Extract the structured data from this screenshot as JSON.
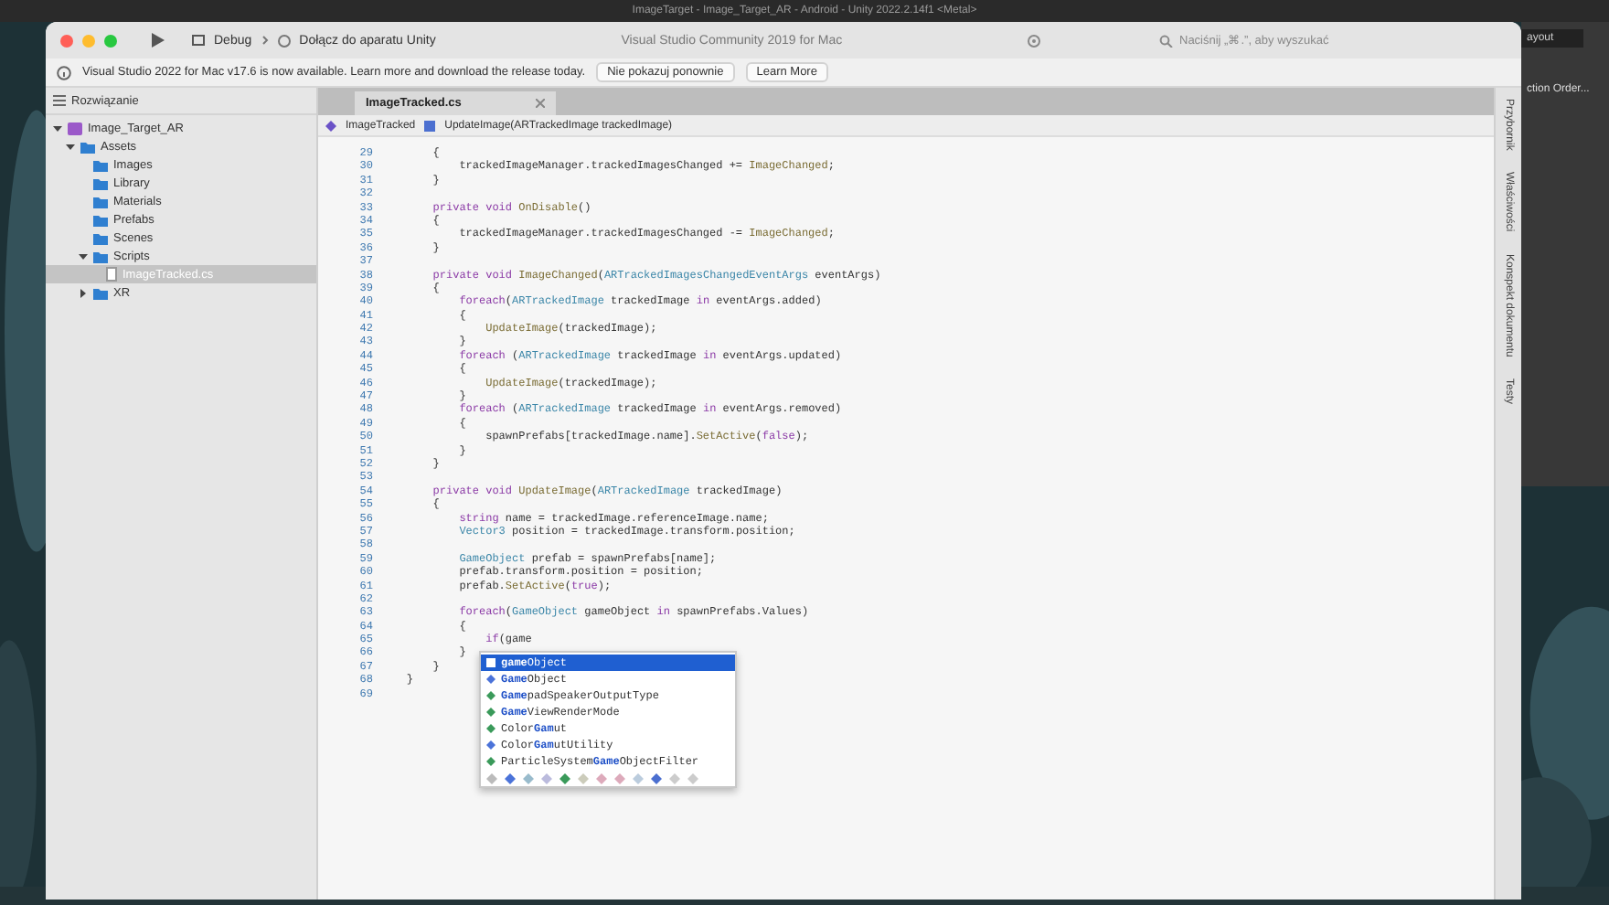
{
  "background_app": {
    "title": "ImageTarget - Image_Target_AR - Android - Unity 2022.2.14f1 <Metal>",
    "layout_dropdown": "ayout",
    "panel_text": "ction Order..."
  },
  "window": {
    "title": "Visual Studio Community 2019 for Mac",
    "run_config": "Debug",
    "target": "Dołącz do aparatu Unity",
    "search_placeholder": "Naciśnij „⌘.”, aby wyszukać"
  },
  "info_bar": {
    "message": "Visual Studio 2022 for Mac v17.6 is now available. Learn more and download the release today.",
    "buttons": [
      "Nie pokazuj ponownie",
      "Learn More"
    ]
  },
  "solution": {
    "title": "Rozwiązanie",
    "tree": [
      {
        "label": "Image_Target_AR",
        "kind": "project",
        "expanded": true,
        "selected": false,
        "children": [
          {
            "label": "Assets",
            "kind": "folder",
            "expanded": true,
            "selected": false,
            "children": [
              {
                "label": "Images",
                "kind": "folder",
                "selected": false
              },
              {
                "label": "Library",
                "kind": "folder",
                "selected": false
              },
              {
                "label": "Materials",
                "kind": "folder",
                "selected": false
              },
              {
                "label": "Prefabs",
                "kind": "folder",
                "selected": false
              },
              {
                "label": "Scenes",
                "kind": "folder",
                "selected": false
              },
              {
                "label": "Scripts",
                "kind": "folder",
                "expanded": true,
                "selected": false,
                "children": [
                  {
                    "label": "ImageTracked.cs",
                    "kind": "file",
                    "selected": true
                  }
                ]
              },
              {
                "label": "XR",
                "kind": "folder",
                "expanded": false,
                "selected": false
              }
            ]
          }
        ]
      }
    ]
  },
  "editor": {
    "tabs": [
      {
        "label": "ImageTracked.cs",
        "selected": true
      }
    ],
    "breadcrumb": [
      "ImageTracked",
      "UpdateImage(ARTrackedImage trackedImage)"
    ],
    "lines": [
      {
        "n": "29",
        "code": [
          {
            "text": "        {",
            "kind": "plain"
          }
        ]
      },
      {
        "n": "30",
        "code": [
          {
            "text": "            trackedImageManager.trackedImagesChanged += ",
            "kind": "plain"
          },
          {
            "text": "ImageChanged",
            "kind": "method"
          },
          {
            "text": ";",
            "kind": "plain"
          }
        ]
      },
      {
        "n": "31",
        "code": [
          {
            "text": "        }",
            "kind": "plain"
          }
        ]
      },
      {
        "n": "32"
      },
      {
        "n": "33",
        "code": [
          {
            "text": "        private void ",
            "kind": "keyword"
          },
          {
            "text": "OnDisable",
            "kind": "method"
          },
          {
            "text": "()",
            "kind": "plain"
          }
        ]
      },
      {
        "n": "34",
        "code": [
          {
            "text": "        {",
            "kind": "plain"
          }
        ]
      },
      {
        "n": "35",
        "code": [
          {
            "text": "            trackedImageManager.trackedImagesChanged -= ",
            "kind": "plain"
          },
          {
            "text": "ImageChanged",
            "kind": "method"
          },
          {
            "text": ";",
            "kind": "plain"
          }
        ]
      },
      {
        "n": "36",
        "code": [
          {
            "text": "        }",
            "kind": "plain"
          }
        ]
      },
      {
        "n": "37"
      },
      {
        "n": "38",
        "code": [
          {
            "text": "        private void ",
            "kind": "keyword"
          },
          {
            "text": "ImageChanged",
            "kind": "method"
          },
          {
            "text": "(",
            "kind": "plain"
          },
          {
            "text": "ARTrackedImagesChangedEventArgs",
            "kind": "type"
          },
          {
            "text": " eventArgs)",
            "kind": "plain"
          }
        ]
      },
      {
        "n": "39",
        "code": [
          {
            "text": "        {",
            "kind": "plain"
          }
        ]
      },
      {
        "n": "40",
        "code": [
          {
            "text": "            foreach",
            "kind": "keyword"
          },
          {
            "text": "(",
            "kind": "plain"
          },
          {
            "text": "ARTrackedImage",
            "kind": "type"
          },
          {
            "text": " trackedImage ",
            "kind": "plain"
          },
          {
            "text": "in",
            "kind": "keyword"
          },
          {
            "text": " eventArgs.added)",
            "kind": "plain"
          }
        ]
      },
      {
        "n": "41",
        "code": [
          {
            "text": "            {",
            "kind": "plain"
          }
        ]
      },
      {
        "n": "42",
        "code": [
          {
            "text": "                UpdateImage",
            "kind": "method"
          },
          {
            "text": "(trackedImage);",
            "kind": "plain"
          }
        ]
      },
      {
        "n": "43",
        "code": [
          {
            "text": "            }",
            "kind": "plain"
          }
        ]
      },
      {
        "n": "44",
        "code": [
          {
            "text": "            foreach",
            "kind": "keyword"
          },
          {
            "text": " (",
            "kind": "plain"
          },
          {
            "text": "ARTrackedImage",
            "kind": "type"
          },
          {
            "text": " trackedImage ",
            "kind": "plain"
          },
          {
            "text": "in",
            "kind": "keyword"
          },
          {
            "text": " eventArgs.updated)",
            "kind": "plain"
          }
        ]
      },
      {
        "n": "45",
        "code": [
          {
            "text": "            {",
            "kind": "plain"
          }
        ]
      },
      {
        "n": "46",
        "code": [
          {
            "text": "                UpdateImage",
            "kind": "method"
          },
          {
            "text": "(trackedImage);",
            "kind": "plain"
          }
        ]
      },
      {
        "n": "47",
        "code": [
          {
            "text": "            }",
            "kind": "plain"
          }
        ]
      },
      {
        "n": "48",
        "code": [
          {
            "text": "            foreach",
            "kind": "keyword"
          },
          {
            "text": " (",
            "kind": "plain"
          },
          {
            "text": "ARTrackedImage",
            "kind": "type"
          },
          {
            "text": " trackedImage ",
            "kind": "plain"
          },
          {
            "text": "in",
            "kind": "keyword"
          },
          {
            "text": " eventArgs.removed)",
            "kind": "plain"
          }
        ]
      },
      {
        "n": "49",
        "code": [
          {
            "text": "            {",
            "kind": "plain"
          }
        ]
      },
      {
        "n": "50",
        "code": [
          {
            "text": "                spawnPrefabs[trackedImage.name].",
            "kind": "plain"
          },
          {
            "text": "SetActive",
            "kind": "method"
          },
          {
            "text": "(",
            "kind": "plain"
          },
          {
            "text": "false",
            "kind": "keyword"
          },
          {
            "text": ");",
            "kind": "plain"
          }
        ]
      },
      {
        "n": "51",
        "code": [
          {
            "text": "            }",
            "kind": "plain"
          }
        ]
      },
      {
        "n": "52",
        "code": [
          {
            "text": "        }",
            "kind": "plain"
          }
        ]
      },
      {
        "n": "53"
      },
      {
        "n": "54",
        "code": [
          {
            "text": "        private void ",
            "kind": "keyword"
          },
          {
            "text": "UpdateImage",
            "kind": "method"
          },
          {
            "text": "(",
            "kind": "plain"
          },
          {
            "text": "ARTrackedImage",
            "kind": "type"
          },
          {
            "text": " trackedImage)",
            "kind": "plain"
          }
        ]
      },
      {
        "n": "55",
        "code": [
          {
            "text": "        {",
            "kind": "plain"
          }
        ]
      },
      {
        "n": "56",
        "code": [
          {
            "text": "            string",
            "kind": "keyword"
          },
          {
            "text": " name = trackedImage.referenceImage.name;",
            "kind": "plain"
          }
        ]
      },
      {
        "n": "57",
        "code": [
          {
            "text": "            Vector3",
            "kind": "type"
          },
          {
            "text": " position = trackedImage.transform.position;",
            "kind": "plain"
          }
        ]
      },
      {
        "n": "58"
      },
      {
        "n": "59",
        "code": [
          {
            "text": "            GameObject",
            "kind": "type"
          },
          {
            "text": " prefab = spawnPrefabs[name];",
            "kind": "plain"
          }
        ]
      },
      {
        "n": "60",
        "code": [
          {
            "text": "            prefab.transform.position = position;",
            "kind": "plain"
          }
        ]
      },
      {
        "n": "61",
        "code": [
          {
            "text": "            prefab.",
            "kind": "plain"
          },
          {
            "text": "SetActive",
            "kind": "method"
          },
          {
            "text": "(",
            "kind": "plain"
          },
          {
            "text": "true",
            "kind": "keyword"
          },
          {
            "text": ");",
            "kind": "plain"
          }
        ]
      },
      {
        "n": "62"
      },
      {
        "n": "63",
        "code": [
          {
            "text": "            foreach",
            "kind": "keyword"
          },
          {
            "text": "(",
            "kind": "plain"
          },
          {
            "text": "GameObject",
            "kind": "type"
          },
          {
            "text": " gameObject ",
            "kind": "plain"
          },
          {
            "text": "in",
            "kind": "keyword"
          },
          {
            "text": " spawnPrefabs.Values)",
            "kind": "plain"
          }
        ]
      },
      {
        "n": "64",
        "code": [
          {
            "text": "            {",
            "kind": "plain"
          }
        ]
      },
      {
        "n": "65",
        "code": [
          {
            "text": "                if",
            "kind": "keyword"
          },
          {
            "text": "(game",
            "kind": "plain"
          }
        ]
      },
      {
        "n": "66",
        "code": [
          {
            "text": "            }",
            "kind": "plain"
          }
        ]
      },
      {
        "n": "67",
        "code": [
          {
            "text": "        }",
            "kind": "plain"
          }
        ]
      },
      {
        "n": "68",
        "code": [
          {
            "text": "    }",
            "kind": "plain"
          }
        ]
      },
      {
        "n": "69"
      }
    ]
  },
  "completion": {
    "items": [
      {
        "text": "**game**Object",
        "kind": "field",
        "selected": true
      },
      {
        "text": "**Game**Object",
        "kind": "class",
        "selected": false
      },
      {
        "text": "**Game**padSpeakerOutputType",
        "kind": "enum",
        "selected": false
      },
      {
        "text": "**Game**ViewRenderMode",
        "kind": "enum",
        "selected": false
      },
      {
        "text": "Color**Gam**ut",
        "kind": "enum",
        "selected": false
      },
      {
        "text": "Color**Gam**utUtility",
        "kind": "class",
        "selected": false
      },
      {
        "text": "ParticleSystem**Game**ObjectFilter",
        "kind": "enum",
        "selected": false
      }
    ]
  },
  "side_tabs": [
    "Przybornik",
    "Właściwości",
    "Konspekt dokumentu",
    "Testy"
  ]
}
